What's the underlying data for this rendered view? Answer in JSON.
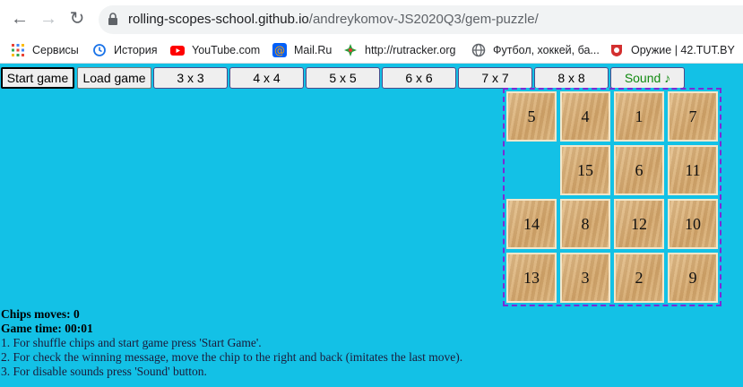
{
  "browser": {
    "url_host": "rolling-scopes-school.github.io",
    "url_path": "/andreykomov-JS2020Q3/gem-puzzle/",
    "bookmarks": [
      {
        "label": "Сервисы",
        "icon": "apps-grid-icon"
      },
      {
        "label": "История",
        "icon": "history-icon"
      },
      {
        "label": "YouTube.com",
        "icon": "youtube-icon"
      },
      {
        "label": "Mail.Ru",
        "icon": "mailru-icon"
      },
      {
        "label": "http://rutracker.org",
        "icon": "rutracker-icon"
      },
      {
        "label": "Футбол, хоккей, ба...",
        "icon": "globe-icon"
      },
      {
        "label": "Оружие | 42.TUT.BY",
        "icon": "tutby-icon"
      }
    ]
  },
  "controls": {
    "start": "Start game",
    "load": "Load game",
    "sizes": [
      "3 x 3",
      "4 x 4",
      "5 x 5",
      "6 x 6",
      "7 x 7",
      "8 x 8"
    ],
    "sound": "Sound ♪"
  },
  "board": {
    "tiles": [
      "5",
      "4",
      "1",
      "7",
      "",
      "15",
      "6",
      "11",
      "14",
      "8",
      "12",
      "10",
      "13",
      "3",
      "2",
      "9"
    ]
  },
  "stats": {
    "moves": "Chips moves: 0",
    "time": "Game time: 00:01"
  },
  "instructions": [
    "1. For shuffle chips and start game press 'Start Game'.",
    "2. For check the winning message, move the chip to the right and back (imitates the last move).",
    "3. For disable sounds press 'Sound' button."
  ],
  "colors": {
    "page_bg": "#13c1e6",
    "board_border": "#7a2bd6",
    "sound_text": "#118a11"
  }
}
